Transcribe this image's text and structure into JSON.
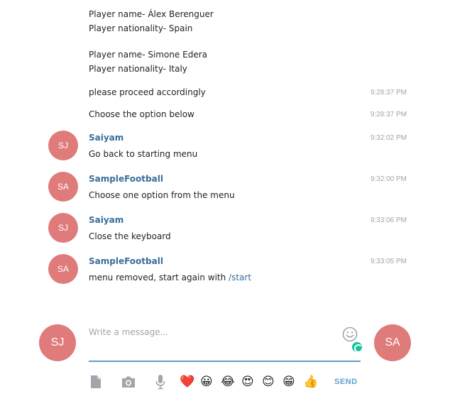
{
  "history": {
    "player1_name": "Player name- Álex Berenguer",
    "player1_nationality": "Player nationality- Spain",
    "player2_name": "Player name- Simone Edera",
    "player2_nationality": "Player nationality- Italy",
    "proceed_text": "please proceed accordingly",
    "proceed_time": "9:28:37 PM",
    "choose_text": "Choose the option below",
    "choose_time": "9:28:37 PM"
  },
  "messages": [
    {
      "avatar": "SJ",
      "sender": "Saiyam",
      "time": "9:32:02 PM",
      "text": "Go back to starting menu"
    },
    {
      "avatar": "SA",
      "sender": "SampleFootball",
      "time": "9:32:00 PM",
      "text": "Choose one option from the menu"
    },
    {
      "avatar": "SJ",
      "sender": "Saiyam",
      "time": "9:33:06 PM",
      "text": "Close the keyboard"
    },
    {
      "avatar": "SA",
      "sender": "SampleFootball",
      "time": "9:33:05 PM",
      "text": "menu removed, start again with ",
      "link": "/start"
    }
  ],
  "composer": {
    "my_avatar": "SJ",
    "peer_avatar": "SA",
    "placeholder": "Write a message...",
    "value": "",
    "send_label": "SEND"
  },
  "emojis": [
    "❤️",
    "😀",
    "😂",
    "😍",
    "😊",
    "😁",
    "👍"
  ],
  "colors": {
    "avatar": "#e07b7b",
    "sender": "#3a6d99",
    "accent": "#5ea0cf",
    "timestamp": "#a0a6ab"
  }
}
